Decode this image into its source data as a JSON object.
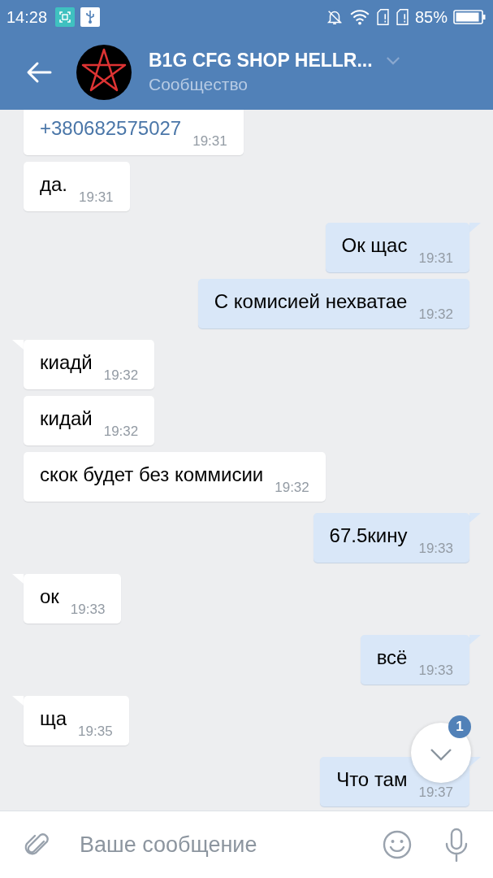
{
  "status_bar": {
    "time": "14:28",
    "battery": "85%"
  },
  "header": {
    "title": "B1G CFG SHOP HELLR...",
    "subtitle": "Сообщество"
  },
  "messages": [
    {
      "kind": "phone",
      "outgoing": false,
      "text": "+380682575027",
      "time": "19:31"
    },
    {
      "kind": "text",
      "outgoing": false,
      "text": "да.",
      "time": "19:31"
    },
    {
      "kind": "text",
      "outgoing": true,
      "text": "Ок щас",
      "time": "19:31"
    },
    {
      "kind": "text",
      "outgoing": true,
      "text": "С комисией нехватае",
      "time": "19:32"
    },
    {
      "kind": "text",
      "outgoing": false,
      "text": "киадй",
      "time": "19:32"
    },
    {
      "kind": "text",
      "outgoing": false,
      "text": "кидай",
      "time": "19:32"
    },
    {
      "kind": "text",
      "outgoing": false,
      "text": "скок будет без коммисии",
      "time": "19:32"
    },
    {
      "kind": "text",
      "outgoing": true,
      "text": "67.5кину",
      "time": "19:33"
    },
    {
      "kind": "text",
      "outgoing": false,
      "text": "ок",
      "time": "19:33"
    },
    {
      "kind": "text",
      "outgoing": true,
      "text": "всё",
      "time": "19:33"
    },
    {
      "kind": "text",
      "outgoing": false,
      "text": "ща",
      "time": "19:35"
    },
    {
      "kind": "text",
      "outgoing": true,
      "text": "Что там",
      "time": "19:37"
    }
  ],
  "scroll_down": {
    "badge": "1"
  },
  "composer": {
    "placeholder": "Ваше сообщение"
  }
}
